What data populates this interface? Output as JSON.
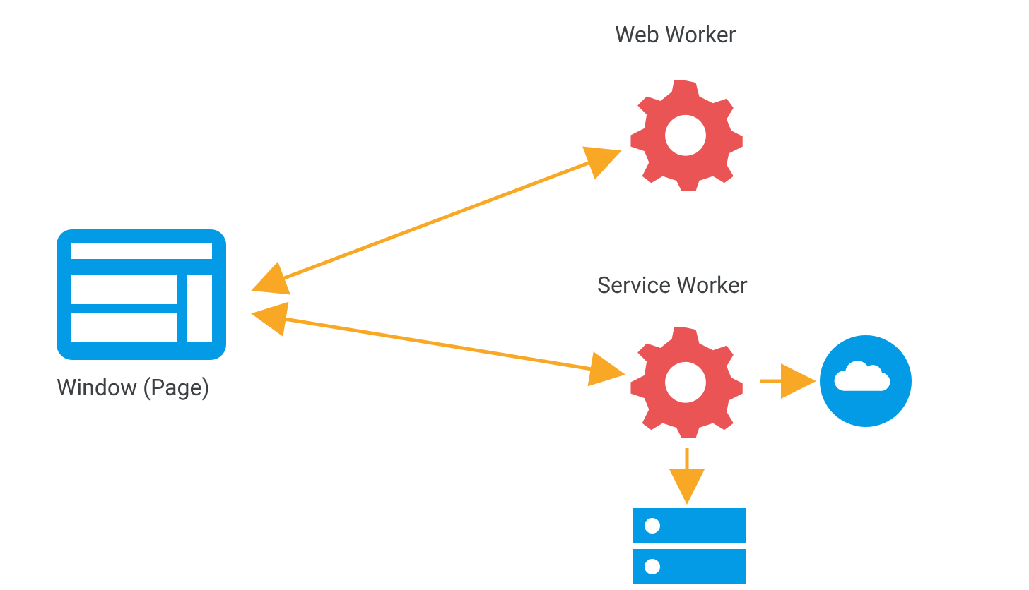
{
  "labels": {
    "window": "Window (Page)",
    "web_worker": "Web Worker",
    "service_worker": "Service Worker"
  },
  "colors": {
    "blue": "#039be5",
    "red": "#ea5455",
    "orange": "#f9a825",
    "text": "#3c4043",
    "white": "#ffffff"
  },
  "nodes": [
    {
      "id": "window",
      "type": "window-page",
      "label_key": "window"
    },
    {
      "id": "web_worker",
      "type": "gear",
      "label_key": "web_worker"
    },
    {
      "id": "service_worker",
      "type": "gear",
      "label_key": "service_worker"
    },
    {
      "id": "cloud",
      "type": "cloud"
    },
    {
      "id": "storage",
      "type": "server-stack"
    }
  ],
  "edges": [
    {
      "from": "window",
      "to": "web_worker",
      "bidirectional": true
    },
    {
      "from": "window",
      "to": "service_worker",
      "bidirectional": true
    },
    {
      "from": "service_worker",
      "to": "cloud",
      "bidirectional": false
    },
    {
      "from": "service_worker",
      "to": "storage",
      "bidirectional": false
    }
  ]
}
